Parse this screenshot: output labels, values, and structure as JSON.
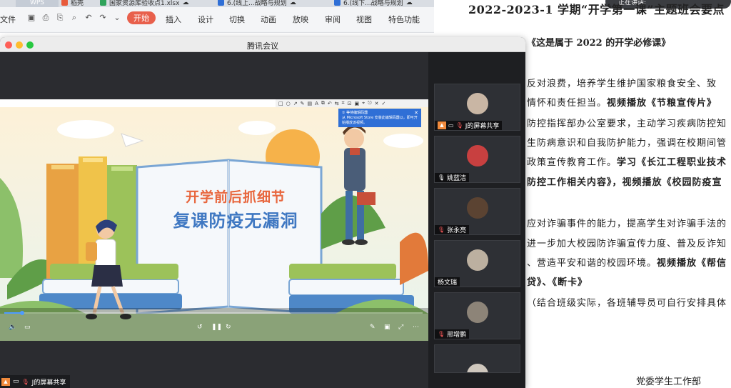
{
  "wps": {
    "tabs": [
      {
        "label": "WPS"
      },
      {
        "label": "稻壳"
      },
      {
        "label": "国家资源库验收点1.xlsx"
      },
      {
        "label": "6.(线上...战略与规划"
      },
      {
        "label": "6.(线下...战略与规划"
      }
    ],
    "menu": {
      "file": "文件",
      "start": "开始",
      "insert": "插入",
      "design": "设计",
      "transition": "切换",
      "animation": "动画",
      "slideshow": "放映",
      "review": "审阅",
      "view": "视图",
      "special": "特色功能"
    }
  },
  "document": {
    "title": "2022-2023-1 学期“开学第一课”主题班会要点",
    "subtitle": "《这是属于 2022 的开学必修课》",
    "status_bubble": "正在讲话:",
    "lines": [
      {
        "plain": "反对浪费，培养学生维护国家粮食安全、致",
        "bold": ""
      },
      {
        "plain": "情怀和责任担当。",
        "bold": "视频播放《节粮宣传片》"
      },
      {
        "plain": "防控指挥部办公室要求，主动学习疾病防控知",
        "bold": ""
      },
      {
        "plain": "生防病意识和自我防护能力，强调在校期间管",
        "bold": ""
      },
      {
        "plain": "政策宣传教育工作。",
        "bold": "学习《长江工程职业技术"
      },
      {
        "plain": "",
        "bold": "防控工作相关内容》，视频播放《校园防疫宣"
      },
      {
        "plain": "应对诈骗事件的能力，提高学生对诈骗手法的",
        "bold": ""
      },
      {
        "plain": "进一步加大校园防诈骗宣传力度、普及反诈知",
        "bold": ""
      },
      {
        "plain": "、营造平安和谐的校园环境。",
        "bold": "视频播放《帮信"
      },
      {
        "plain": "",
        "bold": "贷》、《断卡》"
      },
      {
        "plain": "（结合班级实际，各班辅导员可自行安排具体",
        "bold": ""
      }
    ],
    "signature": "党委学生工作部"
  },
  "meeting": {
    "window_title": "腾讯会议",
    "notification": {
      "title": "① 等待编辑码器",
      "body": "从 Microsoft Store 安装此编辑码器以，即可开始播放该视频。"
    },
    "slide": {
      "headline1": "开学前后抓细节",
      "headline2": "复课防疫无漏洞"
    },
    "video": {
      "progress": 0.04
    },
    "participants": [
      {
        "name": "J的屏幕共享",
        "muted": true,
        "sharing": true,
        "avatar_color": "#c9b6a4"
      },
      {
        "name": "姚蓝洁",
        "muted": false,
        "sharing": false,
        "avatar_color": "#c84040"
      },
      {
        "name": "张永亮",
        "muted": true,
        "sharing": false,
        "avatar_color": "#5b4332"
      },
      {
        "name": "杨文瑞",
        "muted": false,
        "sharing": false,
        "avatar_color": "#bcb0a0"
      },
      {
        "name": "邢增鹏",
        "muted": true,
        "sharing": false,
        "avatar_color": "#8d8478"
      }
    ],
    "bottom_share_label": "J的屏幕共享"
  }
}
